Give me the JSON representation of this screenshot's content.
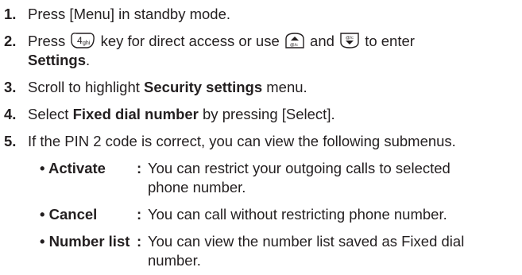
{
  "steps": [
    {
      "number": "1.",
      "text": "Press [Menu] in standby mode."
    },
    {
      "number": "2.",
      "part1": "Press",
      "part2": "key for direct access or use",
      "part3": "and",
      "part4": "to enter",
      "bold": "Settings",
      "tail": "."
    },
    {
      "number": "3.",
      "part1": "Scroll to highlight",
      "bold": "Security settings",
      "tail": "menu."
    },
    {
      "number": "4.",
      "part1": "Select",
      "bold": "Fixed dial number",
      "tail": "by pressing [Select]."
    },
    {
      "number": "5.",
      "text": "If the PIN 2 code is correct, you can view the following submenus."
    }
  ],
  "submenus": [
    {
      "bullet": "•",
      "label": "Activate",
      "colon": ":",
      "line1": "You can restrict your outgoing calls to selected",
      "line2": "phone number."
    },
    {
      "bullet": "•",
      "label": "Cancel",
      "colon": ":",
      "line1": "You can call without restricting phone number."
    },
    {
      "bullet": "•",
      "label": "Number list",
      "colon": ":",
      "line1": "You can view the number list saved as Fixed dial",
      "line2": "number."
    }
  ],
  "icons": {
    "key4": {
      "name": "key-4-ghi-icon",
      "digit": "4",
      "letters": "ghi"
    },
    "up": {
      "name": "nav-up-key-icon",
      "sub": "@/c"
    },
    "down": {
      "name": "nav-down-key-icon",
      "sub": "✉"
    }
  }
}
